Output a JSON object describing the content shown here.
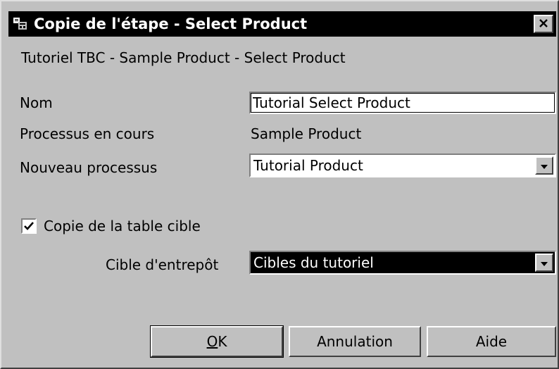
{
  "window": {
    "title": "Copie de l'étape - Select Product",
    "icon": "app-icon",
    "close_icon": "close-icon"
  },
  "header": {
    "path": "Tutoriel TBC - Sample Product - Select Product"
  },
  "form": {
    "name_label": "Nom",
    "name_value": "Tutorial Select Product",
    "current_process_label": "Processus en cours",
    "current_process_value": "Sample Product",
    "new_process_label": "Nouveau processus",
    "new_process_value": "Tutorial Product",
    "copy_target_label": "Copie de la table cible",
    "copy_target_checked": true,
    "warehouse_target_label": "Cible d'entrepôt",
    "warehouse_target_value": "Cibles du tutoriel"
  },
  "buttons": {
    "ok_mnemonic": "O",
    "ok_rest": "K",
    "cancel": "Annulation",
    "help": "Aide"
  }
}
